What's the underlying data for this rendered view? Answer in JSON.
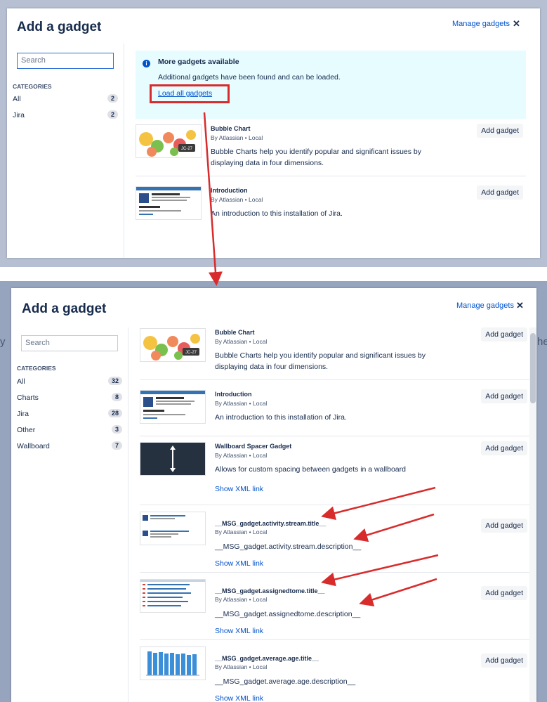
{
  "background_text": {
    "left": "y",
    "right": "he"
  },
  "top_dialog": {
    "title": "Add a gadget",
    "manage_label": "Manage gadgets",
    "close_glyph": "✕",
    "search": {
      "placeholder": "Search",
      "value": ""
    },
    "categories_heading": "CATEGORIES",
    "categories": [
      {
        "label": "All",
        "count": "2"
      },
      {
        "label": "Jira",
        "count": "2"
      }
    ],
    "banner": {
      "icon": "i",
      "title": "More gadgets available",
      "text": "Additional gadgets have been found and can be loaded.",
      "link": "Load all gadgets"
    },
    "gadgets": [
      {
        "title": "Bubble Chart",
        "author": "By Atlassian • Local",
        "description": "Bubble Charts help you identify popular and significant issues by displaying data in four dimensions.",
        "button": "Add gadget",
        "thumb": "bubble-chart-thumbnail"
      },
      {
        "title": "Introduction",
        "author": "By Atlassian • Local",
        "description": "An introduction to this installation of Jira.",
        "button": "Add gadget",
        "thumb": "introduction-thumbnail"
      }
    ]
  },
  "bottom_dialog": {
    "title": "Add a gadget",
    "manage_label": "Manage gadgets",
    "close_glyph": "✕",
    "search": {
      "placeholder": "Search",
      "value": ""
    },
    "categories_heading": "CATEGORIES",
    "categories": [
      {
        "label": "All",
        "count": "32"
      },
      {
        "label": "Charts",
        "count": "8"
      },
      {
        "label": "Jira",
        "count": "28"
      },
      {
        "label": "Other",
        "count": "3"
      },
      {
        "label": "Wallboard",
        "count": "7"
      }
    ],
    "gadgets": [
      {
        "title": "Bubble Chart",
        "author": "By Atlassian • Local",
        "description": "Bubble Charts help you identify popular and significant issues by displaying data in four dimensions.",
        "button": "Add gadget",
        "xml_link": "",
        "thumb": "bubble-chart-thumbnail"
      },
      {
        "title": "Introduction",
        "author": "By Atlassian • Local",
        "description": "An introduction to this installation of Jira.",
        "button": "Add gadget",
        "xml_link": "",
        "thumb": "introduction-thumbnail"
      },
      {
        "title": "Wallboard Spacer Gadget",
        "author": "By Atlassian • Local",
        "description": "Allows for custom spacing between gadgets in a wallboard",
        "button": "Add gadget",
        "xml_link": "Show XML link",
        "thumb": "wallboard-spacer-thumbnail"
      },
      {
        "title": "__MSG_gadget.activity.stream.title__",
        "author": "By Atlassian • Local",
        "description": "__MSG_gadget.activity.stream.description__",
        "button": "Add gadget",
        "xml_link": "Show XML link",
        "thumb": "activity-stream-thumbnail"
      },
      {
        "title": "__MSG_gadget.assignedtome.title__",
        "author": "By Atlassian • Local",
        "description": "__MSG_gadget.assignedtome.description__",
        "button": "Add gadget",
        "xml_link": "Show XML link",
        "thumb": "assigned-to-me-thumbnail"
      },
      {
        "title": "__MSG_gadget.average.age.title__",
        "author": "By Atlassian • Local",
        "description": "__MSG_gadget.average.age.description__",
        "button": "Add gadget",
        "xml_link": "Show XML link",
        "thumb": "average-age-thumbnail"
      }
    ]
  },
  "colors": {
    "annotation_red": "#d82c2c",
    "link_blue": "#0052cc",
    "banner_bg": "#e6fcff"
  }
}
